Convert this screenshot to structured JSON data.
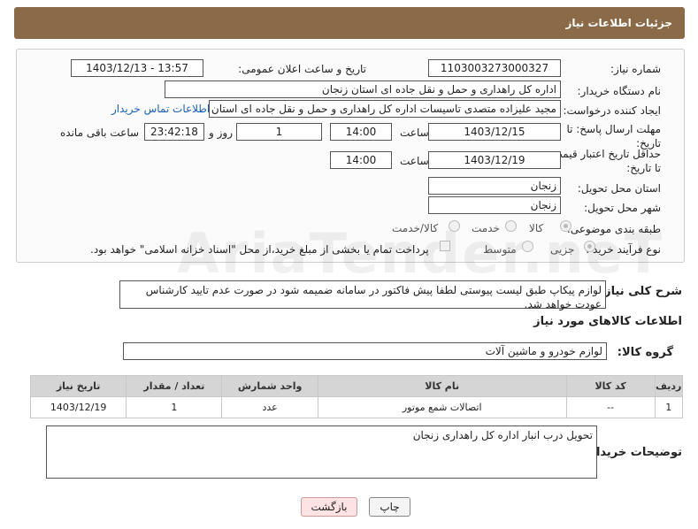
{
  "header": {
    "title": "جزئیات اطلاعات نیاز"
  },
  "fields": {
    "need_number_label": "شماره نیاز:",
    "need_number": "1103003273000327",
    "announce_label": "تاریخ و ساعت اعلان عمومی:",
    "announce_value": "1403/12/13 - 13:57",
    "buyer_org_label": "نام دستگاه خریدار:",
    "buyer_org": "اداره کل راهداری و حمل و نقل جاده ای استان زنجان",
    "creator_label": "ایجاد کننده درخواست:",
    "creator": "مجید علیزاده متصدی تاسیسات اداره کل راهداری و حمل و نقل جاده ای استان ز",
    "contact_link": "اطلاعات تماس خریدار",
    "reply_deadline_label": "مهلت ارسال پاسخ: تا تاریخ:",
    "reply_date": "1403/12/15",
    "time_label": "ساعت",
    "reply_time": "14:00",
    "days_value": "1",
    "days_label": "روز و",
    "remaining_time": "23:42:18",
    "remaining_label": "ساعت باقی مانده",
    "price_validity_label": "حداقل تاریخ اعتبار قیمت: تا تاریخ:",
    "price_date": "1403/12/19",
    "price_time": "14:00",
    "province_label": "استان محل تحویل:",
    "province": "زنجان",
    "city_label": "شهر محل تحویل:",
    "city": "زنجان",
    "category_label": "طبقه بندی موضوعی:",
    "cat_goods": "کالا",
    "cat_service": "خدمت",
    "cat_goods_service": "کالا/خدمت",
    "process_label": "نوع فرآیند خرید :",
    "proc_partial": "جزیی",
    "proc_medium": "متوسط",
    "payment_note": "پرداخت تمام یا بخشی از مبلغ خرید،از محل \"اسناد خزانه اسلامی\" خواهد بود."
  },
  "description": {
    "label": "شرح کلی نیاز:",
    "text": "لوازم پیکاپ طبق لیست پیوستی لطفا پیش فاکتور در سامانه ضمیمه شود در صورت عدم تایید کارشناس عودت خواهد شد."
  },
  "goods_info": {
    "title": "اطلاعات کالاهای مورد نیاز",
    "group_label": "گروه کالا:",
    "group_value": "لوازم خودرو و ماشین آلات"
  },
  "table": {
    "headers": [
      "ردیف",
      "کد کالا",
      "نام کالا",
      "واحد شمارش",
      "تعداد / مقدار",
      "تاریخ نیاز"
    ],
    "rows": [
      [
        "1",
        "--",
        "اتصالات شمع موتور",
        "عدد",
        "1",
        "1403/12/19"
      ]
    ]
  },
  "buyer_notes": {
    "label": "توضیحات خریدار:",
    "text": "تحویل درب انبار اداره کل راهداری زنجان"
  },
  "buttons": {
    "print": "چاپ",
    "back": "بازگشت"
  },
  "watermark": "AriaTender.neT"
}
